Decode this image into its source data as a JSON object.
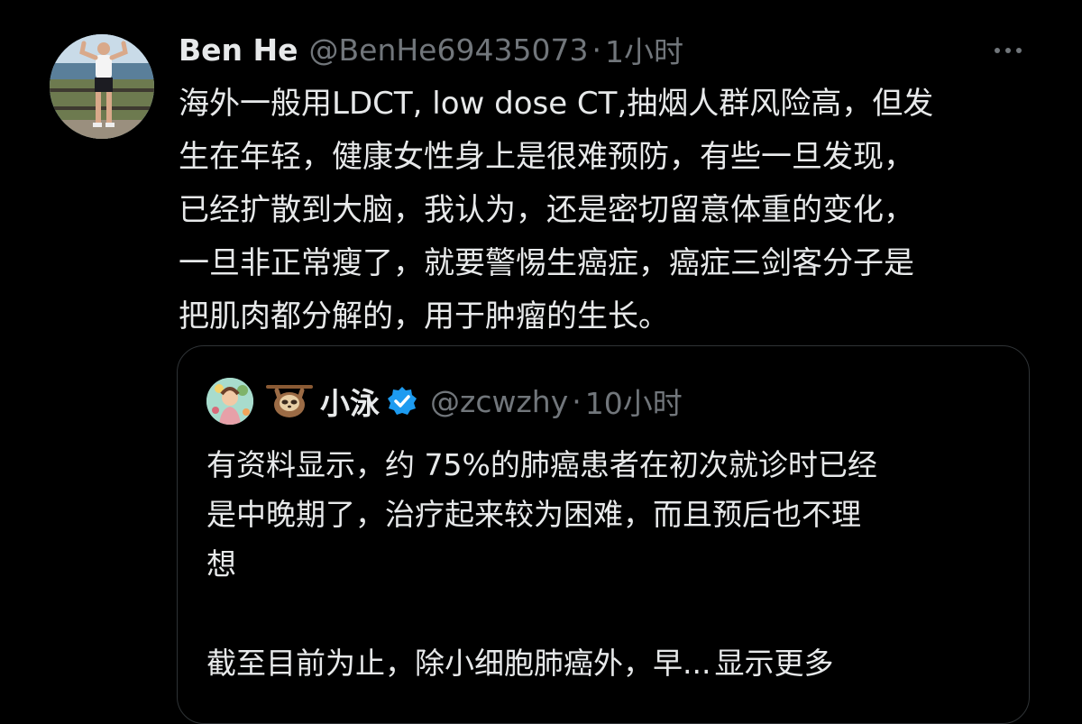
{
  "tweet": {
    "author": {
      "display_name": "Ben He",
      "handle": "@BenHe69435073",
      "avatar_icon": "profile-photo-man-flexing-by-sea"
    },
    "separator": "·",
    "time": "1小时",
    "more_icon": "ellipsis-icon",
    "text_lines": [
      "海外一般用LDCT, low dose CT,抽烟人群风险高，但发",
      "生在年轻，健康女性身上是很难预防，有些一旦发现，",
      "已经扩散到大脑，我认为，还是密切留意体重的变化，",
      "一旦非正常瘦了，就要警惕生癌症，癌症三剑客分子是",
      "把肌肉都分解的，用于肿瘤的生长。"
    ]
  },
  "quoted": {
    "author": {
      "display_name": "小泳",
      "name_emoji_icon": "sloth-icon",
      "verified_icon": "verified-badge-icon",
      "handle": "@zcwzhy",
      "avatar_icon": "illustrated-avatar"
    },
    "separator": "·",
    "time": "10小时",
    "text_lines": [
      "有资料显示，约 75%的肺癌患者在初次就诊时已经",
      "是中晚期了，治疗起来较为困难，而且预后也不理",
      "想"
    ],
    "trailing_text": "截至目前为止，除小细胞肺癌外，早...",
    "show_more_label": "显示更多"
  },
  "colors": {
    "background": "#000000",
    "text_primary": "#e7e9ea",
    "text_secondary": "#71767b",
    "border": "#2f3336",
    "verified": "#1d9bf0"
  }
}
